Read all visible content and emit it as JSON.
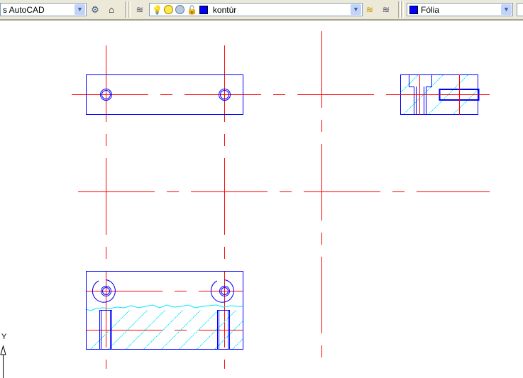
{
  "toolbar": {
    "style_combo": {
      "value": "s AutoCAD"
    },
    "layer_combo": {
      "value": "kontúr",
      "color": "#0000ff"
    },
    "color_combo": {
      "value": "Fólia",
      "color": "#0000ff"
    },
    "icons": [
      "dimension-style-icon",
      "block-icon",
      "layer-manager-icon",
      "lightbulb-icon",
      "sun-icon",
      "freeze-viewport-icon",
      "lock-icon",
      "make-current-layer-icon",
      "layer-previous-icon"
    ]
  },
  "drawing": {
    "ucs_label": "Y",
    "colors": {
      "outline": "#0000ff",
      "center": "#ff0000",
      "hatch": "#00ffff"
    }
  }
}
